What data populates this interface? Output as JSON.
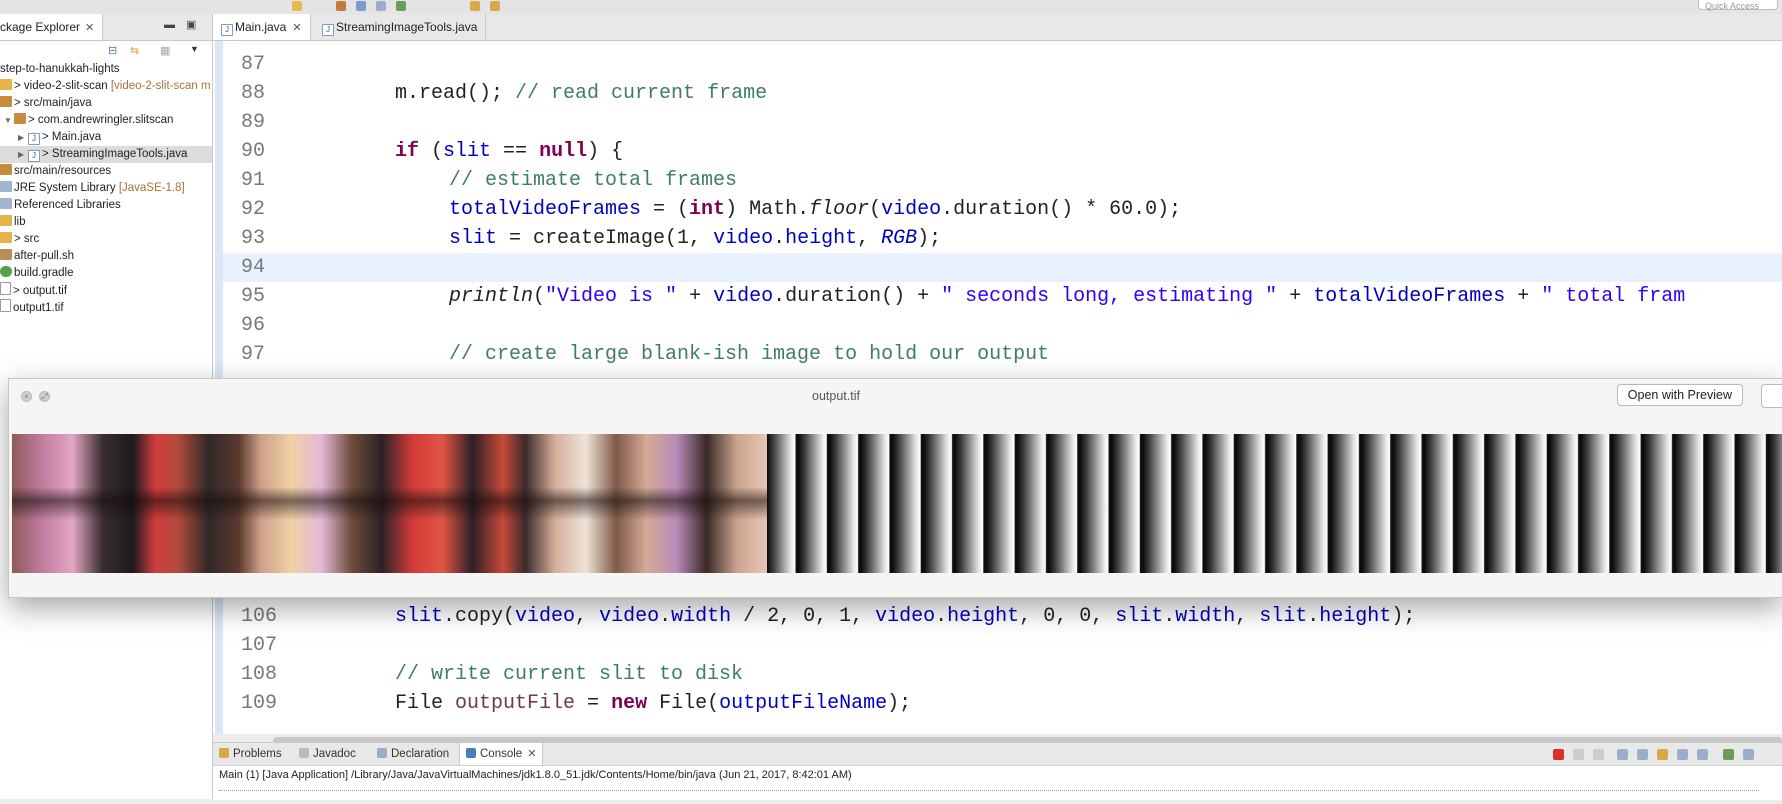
{
  "toolbar": {
    "quick_access_placeholder": "Quick Access"
  },
  "package_explorer": {
    "tab_label": "ckage Explorer",
    "tree": [
      {
        "label": "step-to-hanukkah-lights",
        "decoration": "",
        "icon": "project-icon"
      },
      {
        "label": "> video-2-slit-scan",
        "decoration": "[video-2-slit-scan m",
        "icon": "project-icon"
      },
      {
        "label": "> src/main/java",
        "decoration": "",
        "icon": "source-folder-icon"
      },
      {
        "label": "> com.andrewringler.slitscan",
        "decoration": "",
        "icon": "package-icon"
      },
      {
        "label": "> Main.java",
        "decoration": "",
        "icon": "java-file-icon"
      },
      {
        "label": "> StreamingImageTools.java",
        "decoration": "",
        "icon": "java-file-icon"
      },
      {
        "label": "src/main/resources",
        "decoration": "",
        "icon": "source-folder-icon"
      },
      {
        "label": "JRE System Library",
        "decoration": "[JavaSE-1.8]",
        "icon": "library-icon"
      },
      {
        "label": "Referenced Libraries",
        "decoration": "",
        "icon": "library-icon"
      },
      {
        "label": "lib",
        "decoration": "",
        "icon": "folder-icon"
      },
      {
        "label": "> src",
        "decoration": "",
        "icon": "folder-icon"
      },
      {
        "label": "after-pull.sh",
        "decoration": "",
        "icon": "shell-file-icon"
      },
      {
        "label": "build.gradle",
        "decoration": "",
        "icon": "gradle-file-icon"
      },
      {
        "label": "> output.tif",
        "decoration": "",
        "icon": "image-file-icon"
      },
      {
        "label": "output1.tif",
        "decoration": "",
        "icon": "image-file-icon"
      }
    ]
  },
  "editor": {
    "tabs": [
      {
        "label": "Main.java",
        "active": true
      },
      {
        "label": "StreamingImageTools.java",
        "active": false
      }
    ],
    "lines": {
      "l87": "87",
      "l88": "88",
      "l88_code_a": "m.read(); ",
      "l88_comment": "// read current frame",
      "l89": "89",
      "l90": "90",
      "l90_kw_if": "if",
      "l90_a": " (",
      "l90_fld": "slit",
      "l90_b": " == ",
      "l90_kw_null": "null",
      "l90_c": ") {",
      "l91": "91",
      "l91_comment": "// estimate total frames",
      "l92": "92",
      "l92_fld": "totalVideoFrames",
      "l92_a": " = (",
      "l92_kw": "int",
      "l92_b": ") Math.",
      "l92_it": "floor",
      "l92_c": "(",
      "l92_fld2": "video",
      "l92_d": ".duration() * 60.0);",
      "l93": "93",
      "l93_fld": "slit",
      "l93_a": " = createImage(1, ",
      "l93_fld2": "video",
      "l93_b": ".",
      "l93_fld3": "height",
      "l93_c": ", ",
      "l93_itf": "RGB",
      "l93_d": ");",
      "l94": "94",
      "l95": "95",
      "l95_it": "println",
      "l95_a": "(",
      "l95_st1": "\"Video is \"",
      "l95_b": " + ",
      "l95_fld": "video",
      "l95_c": ".duration() + ",
      "l95_st2": "\" seconds long, estimating \"",
      "l95_d": " + ",
      "l95_fld2": "totalVideoFrames",
      "l95_e": " + ",
      "l95_st3": "\" total fram",
      "l96": "96",
      "l97": "97",
      "l97_comment": "// create large blank-ish image to hold our output",
      "l106": "106",
      "l106_fld": "slit",
      "l106_a": ".copy(",
      "l106_fld2": "video",
      "l106_b": ", ",
      "l106_fld3": "video",
      "l106_c": ".",
      "l106_fld4": "width",
      "l106_d": " / 2, 0, 1, ",
      "l106_fld5": "video",
      "l106_e": ".",
      "l106_fld6": "height",
      "l106_f": ", 0, 0, ",
      "l106_fld7": "slit",
      "l106_g": ".",
      "l106_fld8": "width",
      "l106_h": ", ",
      "l106_fld9": "slit",
      "l106_i": ".",
      "l106_fld10": "height",
      "l106_j": ");",
      "l107": "107",
      "l108": "108",
      "l108_comment": "// write current slit to disk",
      "l109": "109",
      "l109_a": "File ",
      "l109_lv": "outputFile",
      "l109_b": " = ",
      "l109_kw": "new",
      "l109_c": " File(",
      "l109_fld": "outputFileName",
      "l109_d": ");"
    }
  },
  "preview_window": {
    "title": "output.tif",
    "open_button_label": "Open with Preview"
  },
  "console": {
    "tabs": [
      {
        "label": "Problems",
        "active": false
      },
      {
        "label": "Javadoc",
        "active": false
      },
      {
        "label": "Declaration",
        "active": false
      },
      {
        "label": "Console",
        "active": true
      }
    ],
    "description": "Main (1) [Java Application] /Library/Java/JavaVirtualMachines/jdk1.8.0_51.jdk/Contents/Home/bin/java (Jun 21, 2017, 8:42:01 AM)"
  },
  "colors": {
    "keyword": "#7f0055",
    "comment": "#3f7f5f",
    "string": "#2a00ff",
    "field": "#0000c0",
    "current_line": "#e8f2fe"
  }
}
